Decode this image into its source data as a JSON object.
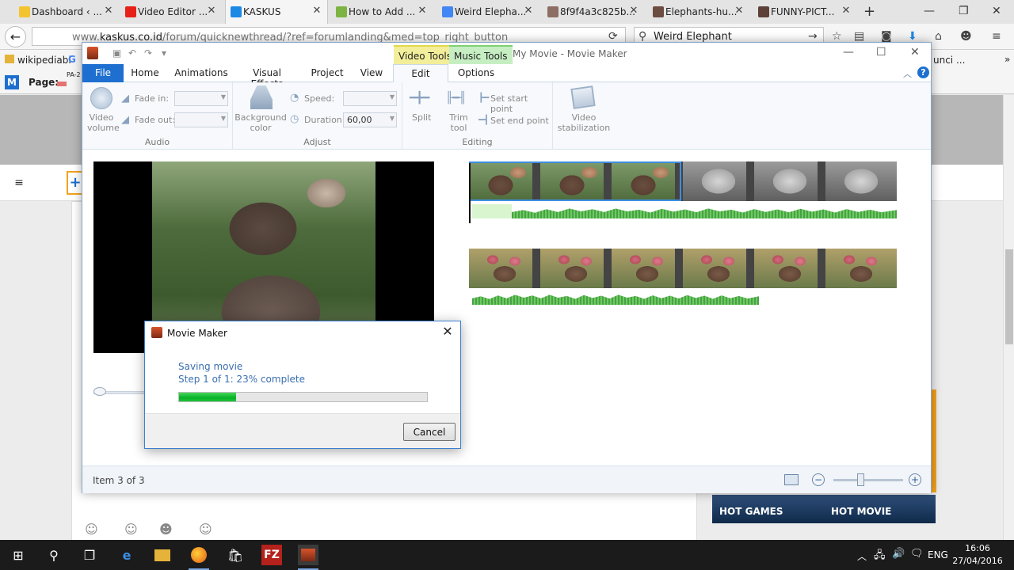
{
  "browser": {
    "tabs": [
      {
        "label": "Dashboard ‹ ...",
        "color": "#f4c430"
      },
      {
        "label": "Video Editor ...",
        "color": "#e62117"
      },
      {
        "label": "KASKUS",
        "color": "#1e88e5"
      },
      {
        "label": "How to Add ...",
        "color": "#7cb342"
      },
      {
        "label": "Weird Elepha...",
        "color": "#4285f4"
      },
      {
        "label": "8f9f4a3c825b...",
        "color": "#8d6e63"
      },
      {
        "label": "Elephants-hu...",
        "color": "#6d4c41"
      },
      {
        "label": "FUNNY-PICT...",
        "color": "#5d4037"
      }
    ],
    "url_prefix": "www.",
    "url_domain": "kaskus.co.id",
    "url_path": "/forum/quicknewthread/?ref=forumlanding&med=top_right_button",
    "search_value": "Weird Elephant",
    "bookmark_1": "wikipediabl",
    "bookmark_2": "unci ...",
    "page_label": "Page:",
    "page_sub": "PA-2"
  },
  "kaskus": {
    "hot_games": "HOT GAMES",
    "hot_movie": "HOT MOVIE"
  },
  "moviemaker": {
    "app_title": "My Movie - Movie Maker",
    "context_video": "Video Tools",
    "context_music": "Music Tools",
    "tabs": {
      "file": "File",
      "home": "Home",
      "animations": "Animations",
      "visual_effects": "Visual Effects",
      "project": "Project",
      "view": "View",
      "edit": "Edit",
      "options": "Options"
    },
    "ribbon": {
      "video_volume": "Video volume",
      "fade_in": "Fade in:",
      "fade_out": "Fade out:",
      "audio_group": "Audio",
      "background_color": "Background color",
      "speed": "Speed:",
      "duration": "Duration:",
      "duration_value": "60,00",
      "adjust_group": "Adjust",
      "split": "Split",
      "trim_tool": "Trim tool",
      "set_start": "Set start point",
      "set_end": "Set end point",
      "editing_group": "Editing",
      "video_stabilization": "Video stabilization"
    },
    "status": "Item 3 of 3"
  },
  "dialog": {
    "title": "Movie Maker",
    "saving": "Saving movie",
    "step": "Step 1 of 1: 23% complete",
    "progress_fraction": 0.23,
    "cancel": "Cancel"
  },
  "taskbar": {
    "language": "ENG",
    "time": "16:06",
    "date": "27/04/2016"
  }
}
